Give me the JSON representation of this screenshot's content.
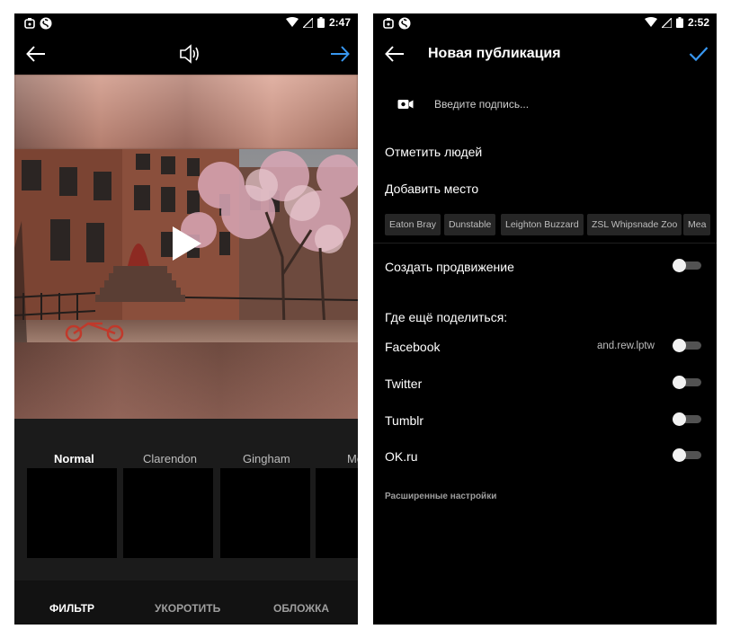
{
  "left_screen": {
    "status_bar": {
      "time": "2:47"
    },
    "filters": {
      "items": [
        {
          "label": "Normal",
          "active": true
        },
        {
          "label": "Clarendon",
          "active": false
        },
        {
          "label": "Gingham",
          "active": false
        },
        {
          "label": "Mo",
          "active": false
        }
      ]
    },
    "bottom_tabs": [
      {
        "label": "ФИЛЬТР",
        "active": true
      },
      {
        "label": "УКОРОТИТЬ",
        "active": false
      },
      {
        "label": "ОБЛОЖКА",
        "active": false
      }
    ],
    "colors": {
      "accent": "#3897f0"
    }
  },
  "right_screen": {
    "status_bar": {
      "time": "2:52"
    },
    "header": {
      "title": "Новая публикация"
    },
    "caption": {
      "placeholder": "Введите подпись..."
    },
    "menu": {
      "tag_people": "Отметить людей",
      "add_location": "Добавить место",
      "create_promotion": "Создать продвижение",
      "share_heading": "Где ещё поделиться:"
    },
    "location_chips": [
      "Eaton Bray",
      "Dunstable",
      "Leighton Buzzard",
      "ZSL Whipsnade Zoo",
      "Mea"
    ],
    "share_targets": [
      {
        "label": "Facebook",
        "account": "and.rew.lptw",
        "enabled": false
      },
      {
        "label": "Twitter",
        "account": "",
        "enabled": false
      },
      {
        "label": "Tumblr",
        "account": "",
        "enabled": false
      },
      {
        "label": "OK.ru",
        "account": "",
        "enabled": false
      }
    ],
    "promotion_enabled": false,
    "advanced_settings": "Расширенные настройки",
    "colors": {
      "accent": "#3897f0"
    }
  }
}
